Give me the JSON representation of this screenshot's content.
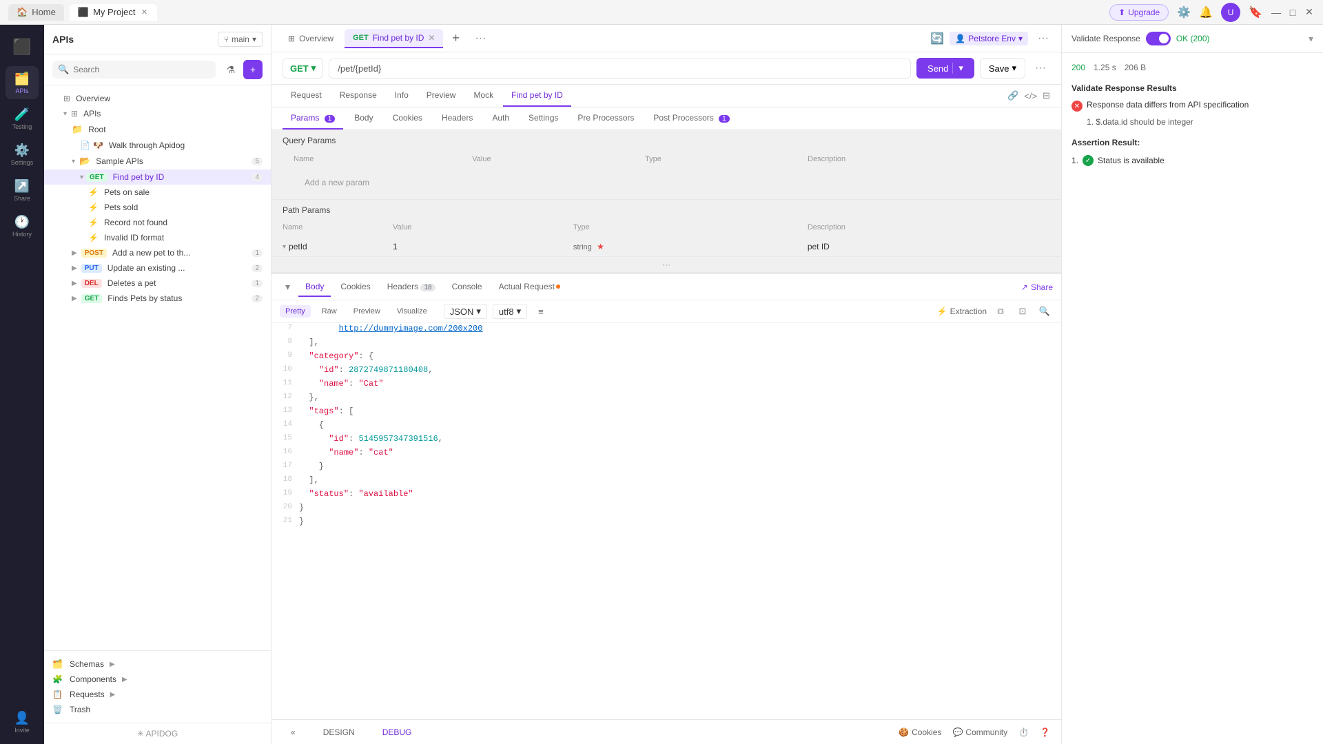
{
  "titleBar": {
    "homeTab": "Home",
    "projectTab": "My Project",
    "upgradeBtn": "Upgrade",
    "windowMin": "—",
    "windowMax": "□",
    "windowClose": "✕"
  },
  "iconSidebar": {
    "items": [
      {
        "icon": "🗂️",
        "label": "APIs",
        "active": true
      },
      {
        "icon": "🧪",
        "label": "Testing"
      },
      {
        "icon": "⚙️",
        "label": "Settings"
      },
      {
        "icon": "↗️",
        "label": "Share"
      },
      {
        "icon": "🕐",
        "label": "History"
      }
    ],
    "bottomItem": {
      "icon": "👤",
      "label": "Invite"
    }
  },
  "leftPanel": {
    "title": "APIs",
    "branch": "main",
    "searchPlaceholder": "Search",
    "filterIcon": "⚗",
    "addIcon": "+",
    "tree": [
      {
        "type": "item",
        "indent": 0,
        "icon": "grid",
        "label": "Overview",
        "active": false
      },
      {
        "type": "item",
        "indent": 0,
        "icon": "grid",
        "label": "APIs",
        "caret": true,
        "active": false
      },
      {
        "type": "item",
        "indent": 1,
        "icon": "folder",
        "label": "Root",
        "active": false
      },
      {
        "type": "item",
        "indent": 2,
        "icon": "file",
        "label": "Walk through Apidog",
        "emoji": "🐶",
        "active": false
      },
      {
        "type": "item",
        "indent": 2,
        "icon": "folder",
        "label": "Sample APIs",
        "count": 5,
        "caret": true,
        "open": true,
        "active": false
      },
      {
        "type": "item",
        "indent": 3,
        "method": "GET",
        "label": "Find pet by ID",
        "count": 4,
        "caret": true,
        "open": true,
        "active": true
      },
      {
        "type": "item",
        "indent": 4,
        "icon": "lightning",
        "label": "Pets on sale",
        "active": false
      },
      {
        "type": "item",
        "indent": 4,
        "icon": "lightning",
        "label": "Pets sold",
        "active": false
      },
      {
        "type": "item",
        "indent": 4,
        "icon": "lightning",
        "label": "Record not found",
        "active": false
      },
      {
        "type": "item",
        "indent": 4,
        "icon": "lightning",
        "label": "Invalid ID format",
        "active": false
      },
      {
        "type": "item",
        "indent": 2,
        "method": "POST",
        "label": "Add a new pet to th...",
        "count": 1,
        "caret": true,
        "active": false
      },
      {
        "type": "item",
        "indent": 2,
        "method": "PUT",
        "label": "Update an existing ...",
        "count": 2,
        "caret": true,
        "active": false
      },
      {
        "type": "item",
        "indent": 2,
        "method": "DEL",
        "label": "Deletes a pet",
        "count": 1,
        "caret": true,
        "active": false
      },
      {
        "type": "item",
        "indent": 2,
        "method": "GET",
        "label": "Finds Pets by status",
        "count": 2,
        "caret": true,
        "active": false
      }
    ],
    "bottomItems": [
      {
        "icon": "🗂️",
        "label": "Schemas"
      },
      {
        "icon": "🧩",
        "label": "Components"
      },
      {
        "icon": "📋",
        "label": "Requests"
      },
      {
        "icon": "🗑️",
        "label": "Trash"
      }
    ]
  },
  "tabs": {
    "items": [
      {
        "label": "Overview",
        "icon": "grid",
        "active": false
      },
      {
        "label": "Find pet by ID",
        "method": "GET",
        "active": true,
        "closable": true
      }
    ],
    "addBtn": "+",
    "moreBtn": "···"
  },
  "requestBar": {
    "method": "GET",
    "url": "/pet/{petId}",
    "sendBtn": "Send",
    "saveBtn": "Save"
  },
  "subTabs": {
    "items": [
      {
        "label": "Request",
        "active": false
      },
      {
        "label": "Response",
        "active": false
      },
      {
        "label": "Info",
        "active": false
      },
      {
        "label": "Preview",
        "active": false
      },
      {
        "label": "Mock",
        "active": false
      },
      {
        "label": "Find pet by ID",
        "active": true
      }
    ]
  },
  "paramsTabs": {
    "items": [
      {
        "label": "Params",
        "badge": "1",
        "active": true
      },
      {
        "label": "Body",
        "active": false
      },
      {
        "label": "Cookies",
        "active": false
      },
      {
        "label": "Headers",
        "active": false
      },
      {
        "label": "Auth",
        "active": false
      },
      {
        "label": "Settings",
        "active": false
      },
      {
        "label": "Pre Processors",
        "active": false
      },
      {
        "label": "Post Processors",
        "badge": "1",
        "active": false
      }
    ]
  },
  "queryParams": {
    "title": "Query Params",
    "columns": [
      "Name",
      "Value",
      "Type",
      "Description"
    ],
    "addPlaceholder": "Add a new param",
    "rows": []
  },
  "pathParams": {
    "title": "Path Params",
    "columns": [
      "Name",
      "Value",
      "Type",
      "Description"
    ],
    "rows": [
      {
        "name": "petId",
        "value": "1",
        "type": "string",
        "required": true,
        "description": "pet ID"
      }
    ]
  },
  "responseTabs": {
    "items": [
      {
        "label": "Body",
        "active": true
      },
      {
        "label": "Cookies",
        "active": false
      },
      {
        "label": "Headers",
        "badge": "18",
        "active": false
      },
      {
        "label": "Console",
        "active": false
      },
      {
        "label": "Actual Request",
        "notification": true,
        "active": false
      }
    ],
    "shareBtn": "Share"
  },
  "responseToolbar": {
    "formats": [
      "Pretty",
      "Raw",
      "Preview",
      "Visualize"
    ],
    "activeFormat": "Pretty",
    "encoding": "JSON",
    "charset": "utf8",
    "extraction": "Extraction",
    "icons": [
      "copy",
      "wrap",
      "search"
    ]
  },
  "codeLines": [
    {
      "num": 7,
      "content": "    ",
      "url": "http://dummyimage.com/200x200"
    },
    {
      "num": 8,
      "content": "  ],"
    },
    {
      "num": 9,
      "content": "  \"category\": {"
    },
    {
      "num": 10,
      "content": "    \"id\": 2872749871180408,"
    },
    {
      "num": 11,
      "content": "    \"name\": \"Cat\""
    },
    {
      "num": 12,
      "content": "  },"
    },
    {
      "num": 13,
      "content": "  \"tags\": ["
    },
    {
      "num": 14,
      "content": "    {"
    },
    {
      "num": 15,
      "content": "      \"id\": 5145957347391516,"
    },
    {
      "num": 16,
      "content": "      \"name\": \"cat\""
    },
    {
      "num": 17,
      "content": "    }"
    },
    {
      "num": 18,
      "content": "  ],"
    },
    {
      "num": 19,
      "content": "  \"status\": \"available\""
    },
    {
      "num": 20,
      "content": "}"
    },
    {
      "num": 21,
      "content": "}"
    }
  ],
  "rightPanel": {
    "validateLabel": "Validate Response",
    "statusLabel": "OK (200)",
    "stats": {
      "statusCode": "200",
      "time": "1.25 s",
      "size": "206 B"
    },
    "validateResultsTitle": "Validate Response Results",
    "errors": [
      {
        "type": "error",
        "text": "Response data differs from API specification"
      },
      {
        "text": "1. $.data.id should be integer"
      }
    ],
    "assertionTitle": "Assertion Result:",
    "assertions": [
      {
        "type": "success",
        "text": "Status is available"
      }
    ]
  },
  "envBar": {
    "icon": "🌐",
    "label": "Petstore Env"
  },
  "bottomBar": {
    "tabs": [
      "DESIGN",
      "DEBUG"
    ],
    "activeTab": "DEBUG",
    "rightItems": [
      {
        "icon": "🍪",
        "label": "Cookies"
      },
      {
        "icon": "💬",
        "label": "Community"
      },
      {
        "icon": "⏱️",
        "label": ""
      },
      {
        "icon": "🔔",
        "label": ""
      },
      {
        "icon": "❓",
        "label": ""
      }
    ]
  }
}
